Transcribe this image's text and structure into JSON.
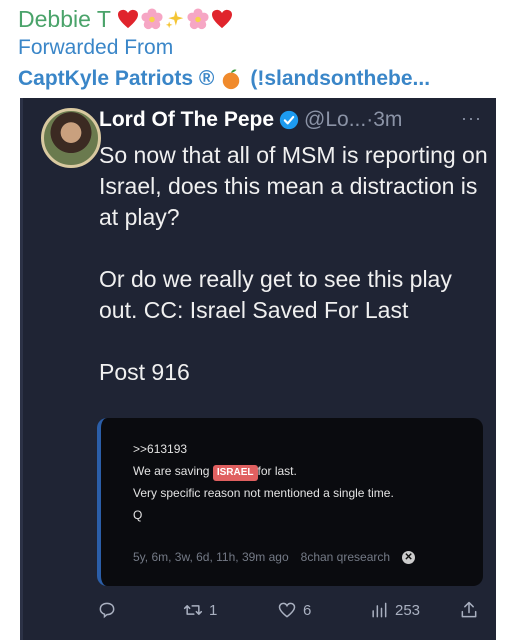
{
  "message": {
    "sender": "Debbie T",
    "forwarded_label": "Forwarded From",
    "forwarded_source": "CaptKyle Patriots ®",
    "forwarded_handle": "(!slandsonthebe..."
  },
  "tweet": {
    "display_name": "Lord Of The Pepe",
    "handle": "@Lo...",
    "time": "·3m",
    "more": "···",
    "paragraphs": [
      "So now that all of MSM is reporting on Israel, does this mean a distraction is at play?",
      "Or do we really get to see this play out. CC: Israel Saved For Last",
      "Post 916"
    ],
    "embed": {
      "line1": ">>613193",
      "line2_pre": "We are saving ",
      "line2_tag": "ISRAEL",
      "line2_post": "for last.",
      "line3": "Very specific reason not mentioned a single time.",
      "line4": "Q",
      "meta_time": "5y, 6m, 3w, 6d, 11h, 39m ago",
      "meta_board": "8chan qresearch",
      "close_glyph": "✕"
    },
    "actions": {
      "reply_count": "",
      "retweet_count": "1",
      "like_count": "6",
      "views_count": "253"
    }
  },
  "colors": {
    "sender": "#4aa36a",
    "link": "#3a86c8",
    "tweet_bg": "#1f2434",
    "embed_bg": "#0a0b0f"
  },
  "icons": [
    "heart-icon",
    "flower-icon",
    "sparkles-icon",
    "peach-icon",
    "verified-badge-icon",
    "reply-icon",
    "retweet-icon",
    "like-icon",
    "views-icon",
    "share-icon"
  ]
}
